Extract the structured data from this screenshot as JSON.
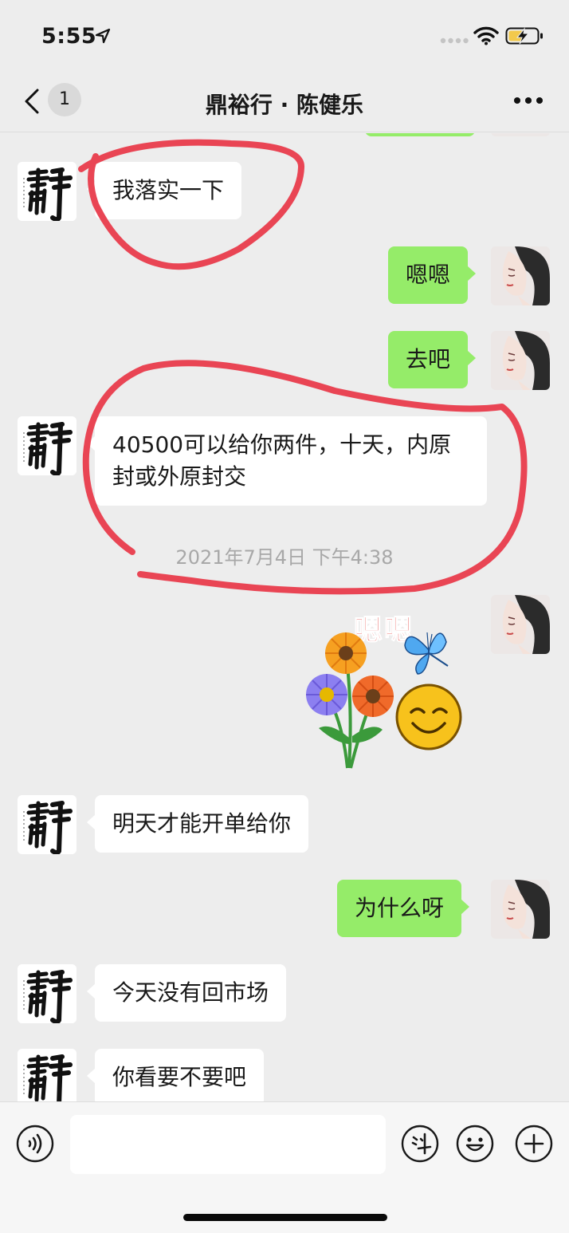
{
  "status_bar": {
    "time": "5:55"
  },
  "header": {
    "back_count": "1",
    "title": "鼎裕行 · 陈健乐"
  },
  "messages": [
    {
      "side": "left",
      "text": "我落实一下"
    },
    {
      "side": "right",
      "text": "嗯嗯"
    },
    {
      "side": "right",
      "text": "去吧"
    },
    {
      "side": "left",
      "text": "40500可以给你两件，十天，内原封或外原封交"
    },
    {
      "type": "timestamp",
      "text": "2021年7月4日 下午4:38"
    },
    {
      "side": "right",
      "type": "sticker",
      "caption": "嗯嗯"
    },
    {
      "side": "left",
      "text": "明天才能开单给你"
    },
    {
      "side": "right",
      "text": "为什么呀"
    },
    {
      "side": "left",
      "text": "今天没有回市场"
    },
    {
      "side": "left",
      "text": "你看要不要吧"
    }
  ],
  "colors": {
    "background": "#ededed",
    "bubble_right": "#95ec69",
    "bubble_left": "#ffffff",
    "annotation": "#e94554"
  },
  "icons": [
    "location-arrow-icon",
    "wifi-icon",
    "battery-charging-icon",
    "back-chevron-icon",
    "more-icon",
    "voice-icon",
    "sticker-icon",
    "emoji-icon",
    "plus-icon"
  ]
}
